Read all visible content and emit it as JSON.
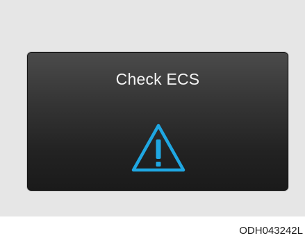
{
  "display": {
    "message": "Check ECS",
    "icon": "warning-triangle-icon",
    "icon_color": "#1fa7e2"
  },
  "caption": {
    "code": "ODH043242L"
  }
}
